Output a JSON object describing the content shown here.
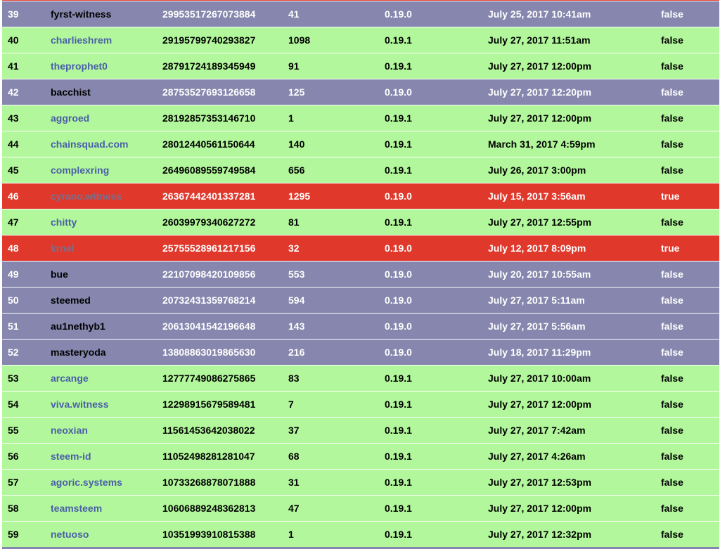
{
  "colors": {
    "active": "#b2f79b",
    "outdated_version": "#8686ae",
    "disabled": "#e0382b"
  },
  "witness_table": {
    "rows": [
      {
        "rank": "39",
        "name": "fyrst-witness",
        "approval": "29953517267073884",
        "votes": "41",
        "version": "0.19.0",
        "last_update": "July 25, 2017 10:41am",
        "disabled": "false",
        "status": "purple"
      },
      {
        "rank": "40",
        "name": "charlieshrem",
        "approval": "29195799740293827",
        "votes": "1098",
        "version": "0.19.1",
        "last_update": "July 27, 2017 11:51am",
        "disabled": "false",
        "status": "green"
      },
      {
        "rank": "41",
        "name": "theprophet0",
        "approval": "28791724189345949",
        "votes": "91",
        "version": "0.19.1",
        "last_update": "July 27, 2017 12:00pm",
        "disabled": "false",
        "status": "green"
      },
      {
        "rank": "42",
        "name": "bacchist",
        "approval": "28753527693126658",
        "votes": "125",
        "version": "0.19.0",
        "last_update": "July 27, 2017 12:20pm",
        "disabled": "false",
        "status": "purple"
      },
      {
        "rank": "43",
        "name": "aggroed",
        "approval": "28192857353146710",
        "votes": "1",
        "version": "0.19.1",
        "last_update": "July 27, 2017 12:00pm",
        "disabled": "false",
        "status": "green"
      },
      {
        "rank": "44",
        "name": "chainsquad.com",
        "approval": "28012440561150644",
        "votes": "140",
        "version": "0.19.1",
        "last_update": "March 31, 2017 4:59pm",
        "disabled": "false",
        "status": "green"
      },
      {
        "rank": "45",
        "name": "complexring",
        "approval": "26496089559749584",
        "votes": "656",
        "version": "0.19.1",
        "last_update": "July 26, 2017 3:00pm",
        "disabled": "false",
        "status": "green"
      },
      {
        "rank": "46",
        "name": "cyrano.witness",
        "approval": "26367442401337281",
        "votes": "1295",
        "version": "0.19.0",
        "last_update": "July 15, 2017 3:56am",
        "disabled": "true",
        "status": "red"
      },
      {
        "rank": "47",
        "name": "chitty",
        "approval": "26039979340627272",
        "votes": "81",
        "version": "0.19.1",
        "last_update": "July 27, 2017 12:55pm",
        "disabled": "false",
        "status": "green"
      },
      {
        "rank": "48",
        "name": "krnel",
        "approval": "25755528961217156",
        "votes": "32",
        "version": "0.19.0",
        "last_update": "July 12, 2017 8:09pm",
        "disabled": "true",
        "status": "red"
      },
      {
        "rank": "49",
        "name": "bue",
        "approval": "22107098420109856",
        "votes": "553",
        "version": "0.19.0",
        "last_update": "July 20, 2017 10:55am",
        "disabled": "false",
        "status": "purple"
      },
      {
        "rank": "50",
        "name": "steemed",
        "approval": "20732431359768214",
        "votes": "594",
        "version": "0.19.0",
        "last_update": "July 27, 2017 5:11am",
        "disabled": "false",
        "status": "purple"
      },
      {
        "rank": "51",
        "name": "au1nethyb1",
        "approval": "20613041542196648",
        "votes": "143",
        "version": "0.19.0",
        "last_update": "July 27, 2017 5:56am",
        "disabled": "false",
        "status": "purple"
      },
      {
        "rank": "52",
        "name": "masteryoda",
        "approval": "13808863019865630",
        "votes": "216",
        "version": "0.19.0",
        "last_update": "July 18, 2017 11:29pm",
        "disabled": "false",
        "status": "purple"
      },
      {
        "rank": "53",
        "name": "arcange",
        "approval": "12777749086275865",
        "votes": "83",
        "version": "0.19.1",
        "last_update": "July 27, 2017 10:00am",
        "disabled": "false",
        "status": "green"
      },
      {
        "rank": "54",
        "name": "viva.witness",
        "approval": "12298915679589481",
        "votes": "7",
        "version": "0.19.1",
        "last_update": "July 27, 2017 12:00pm",
        "disabled": "false",
        "status": "green"
      },
      {
        "rank": "55",
        "name": "neoxian",
        "approval": "11561453642038022",
        "votes": "37",
        "version": "0.19.1",
        "last_update": "July 27, 2017 7:42am",
        "disabled": "false",
        "status": "green"
      },
      {
        "rank": "56",
        "name": "steem-id",
        "approval": "11052498281281047",
        "votes": "68",
        "version": "0.19.1",
        "last_update": "July 27, 2017 4:26am",
        "disabled": "false",
        "status": "green"
      },
      {
        "rank": "57",
        "name": "agoric.systems",
        "approval": "10733268878071888",
        "votes": "31",
        "version": "0.19.1",
        "last_update": "July 27, 2017 12:53pm",
        "disabled": "false",
        "status": "green"
      },
      {
        "rank": "58",
        "name": "teamsteem",
        "approval": "10606889248362813",
        "votes": "47",
        "version": "0.19.1",
        "last_update": "July 27, 2017 12:00pm",
        "disabled": "false",
        "status": "green"
      },
      {
        "rank": "59",
        "name": "netuoso",
        "approval": "10351993910815388",
        "votes": "1",
        "version": "0.19.1",
        "last_update": "July 27, 2017 12:32pm",
        "disabled": "false",
        "status": "green"
      }
    ]
  }
}
